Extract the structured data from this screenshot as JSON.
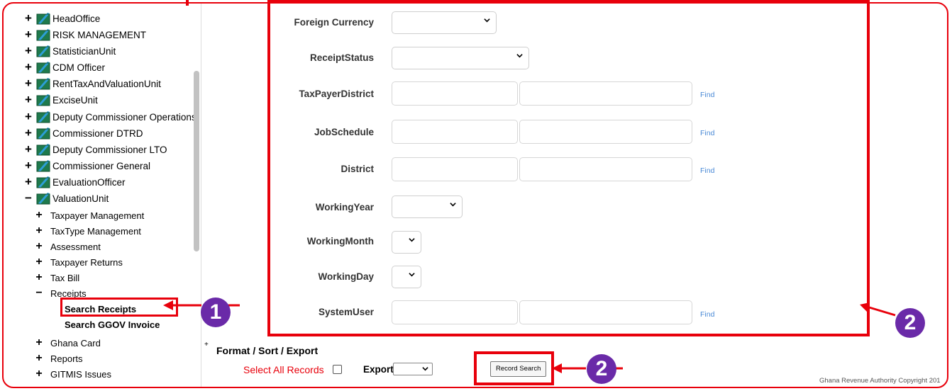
{
  "tree": {
    "units": [
      {
        "label": "HeadOffice",
        "toggle": "+"
      },
      {
        "label": "RISK MANAGEMENT",
        "toggle": "+"
      },
      {
        "label": "StatisticianUnit",
        "toggle": "+"
      },
      {
        "label": "CDM Officer",
        "toggle": "+"
      },
      {
        "label": "RentTaxAndValuationUnit",
        "toggle": "+"
      },
      {
        "label": "ExciseUnit",
        "toggle": "+"
      },
      {
        "label": "Deputy Commissioner Operations",
        "toggle": "+"
      },
      {
        "label": "Commissioner DTRD",
        "toggle": "+"
      },
      {
        "label": "Deputy Commissioner LTO",
        "toggle": "+"
      },
      {
        "label": "Commissioner General",
        "toggle": "+"
      },
      {
        "label": "EvaluationOfficer",
        "toggle": "+"
      },
      {
        "label": "ValuationUnit",
        "toggle": "−"
      }
    ],
    "valuation_children": [
      {
        "label": "Taxpayer Management",
        "toggle": "+"
      },
      {
        "label": "TaxType Management",
        "toggle": "+"
      },
      {
        "label": "Assessment",
        "toggle": "+"
      },
      {
        "label": "Taxpayer Returns",
        "toggle": "+"
      },
      {
        "label": "Tax Bill",
        "toggle": "+"
      },
      {
        "label": "Receipts",
        "toggle": "−"
      },
      {
        "label": "Ghana Card",
        "toggle": "+"
      },
      {
        "label": "Reports",
        "toggle": "+"
      },
      {
        "label": "GITMIS Issues",
        "toggle": "+"
      }
    ],
    "receipts_children": [
      "Search Receipts",
      "Search GGOV Invoice"
    ]
  },
  "form": {
    "foreign_currency": "Foreign Currency",
    "receipt_status": "ReceiptStatus",
    "taxpayer_district": "TaxPayerDistrict",
    "job_schedule": "JobSchedule",
    "district": "District",
    "working_year": "WorkingYear",
    "working_month": "WorkingMonth",
    "working_day": "WorkingDay",
    "system_user": "SystemUser",
    "find": "Find"
  },
  "footer": {
    "plus": "+",
    "section_title": "Format / Sort / Export",
    "select_all": "Select All Records",
    "export_label": "Export",
    "record_search": "Record Search",
    "copyright": "Ghana Revenue Authority Copyright 201"
  },
  "annotations": {
    "badge1": "1",
    "badge2a": "2",
    "badge2b": "2"
  },
  "colors": {
    "highlight": "#e8000b",
    "badge": "#6a2aa8",
    "link": "#4a8ad6",
    "select_all": "#e8000b"
  }
}
